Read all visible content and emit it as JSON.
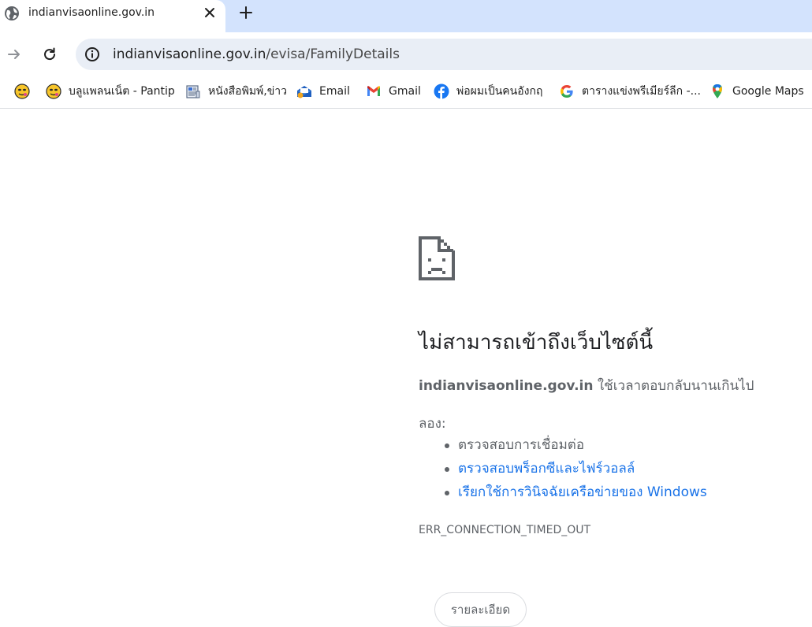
{
  "browser": {
    "tab": {
      "title": "indianvisaonline.gov.in",
      "favicon": "globe-icon",
      "close_icon": "close-icon"
    },
    "new_tab_icon": "plus-icon",
    "toolbar": {
      "forward_icon": "arrow-forward-icon",
      "reload_icon": "reload-icon",
      "site_info_icon": "info-icon",
      "url_host": "indianvisaonline.gov.in",
      "url_path": "/evisa/FamilyDetails"
    },
    "bookmarks": [
      {
        "label": "",
        "icon": "emoji-face-icon"
      },
      {
        "label": "บลูแพลนเน็ต - Pantip",
        "icon": "emoji-face-icon"
      },
      {
        "label": "หนังสือพิมพ์,ข่าว",
        "icon": "newspaper-icon"
      },
      {
        "label": "Email",
        "icon": "mail-app-icon"
      },
      {
        "label": "Gmail",
        "icon": "gmail-icon"
      },
      {
        "label": "พ่อผมเป็นคนอังกฤ",
        "icon": "facebook-icon"
      },
      {
        "label": "ตารางแข่งพรีเมียร์ลีก -...",
        "icon": "google-icon"
      },
      {
        "label": "Google Maps",
        "icon": "google-maps-icon"
      }
    ]
  },
  "error": {
    "icon": "sad-page-icon",
    "title": "ไม่สามารถเข้าถึงเว็บไซต์นี้",
    "host": "indianvisaonline.gov.in",
    "message": " ใช้เวลาตอบกลับนานเกินไป",
    "try_label": "ลอง:",
    "suggestions": [
      "ตรวจสอบการเชื่อมต่อ",
      "ตรวจสอบพร็อกซีและไฟร์วอลล์",
      "เรียกใช้การวินิจฉัยเครือข่ายของ Windows"
    ],
    "code": "ERR_CONNECTION_TIMED_OUT",
    "details_button": "รายละเอียด"
  },
  "colors": {
    "tabstrip_bg": "#d3e3fd",
    "omnibox_bg": "#e9eef6",
    "link": "#1a73e8",
    "secondary_text": "#5f6368"
  }
}
